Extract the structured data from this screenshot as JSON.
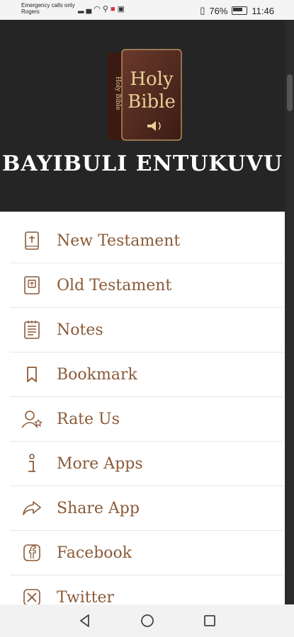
{
  "status_bar": {
    "carrier_line1": "Emergency calls only",
    "carrier_line2": "Rogers",
    "battery": "76%",
    "time": "11:46"
  },
  "drawer": {
    "logo_line1": "Holy",
    "logo_line2": "Bible",
    "logo_spine": "Holy Bible",
    "title": "BAYIBULI ENTUKUVU",
    "menu": [
      {
        "label": "New Testament",
        "icon": "book-icon"
      },
      {
        "label": "Old Testament",
        "icon": "bible-icon"
      },
      {
        "label": "Notes",
        "icon": "notes-icon"
      },
      {
        "label": "Bookmark",
        "icon": "bookmark-icon"
      },
      {
        "label": "Rate Us",
        "icon": "rate-us-icon"
      },
      {
        "label": "More Apps",
        "icon": "info-icon"
      },
      {
        "label": "Share App",
        "icon": "share-icon"
      },
      {
        "label": "Facebook",
        "icon": "facebook-icon"
      },
      {
        "label": "Twitter",
        "icon": "twitter-icon"
      }
    ]
  },
  "colors": {
    "accent": "#8a5a38",
    "header_bg": "#252525"
  }
}
